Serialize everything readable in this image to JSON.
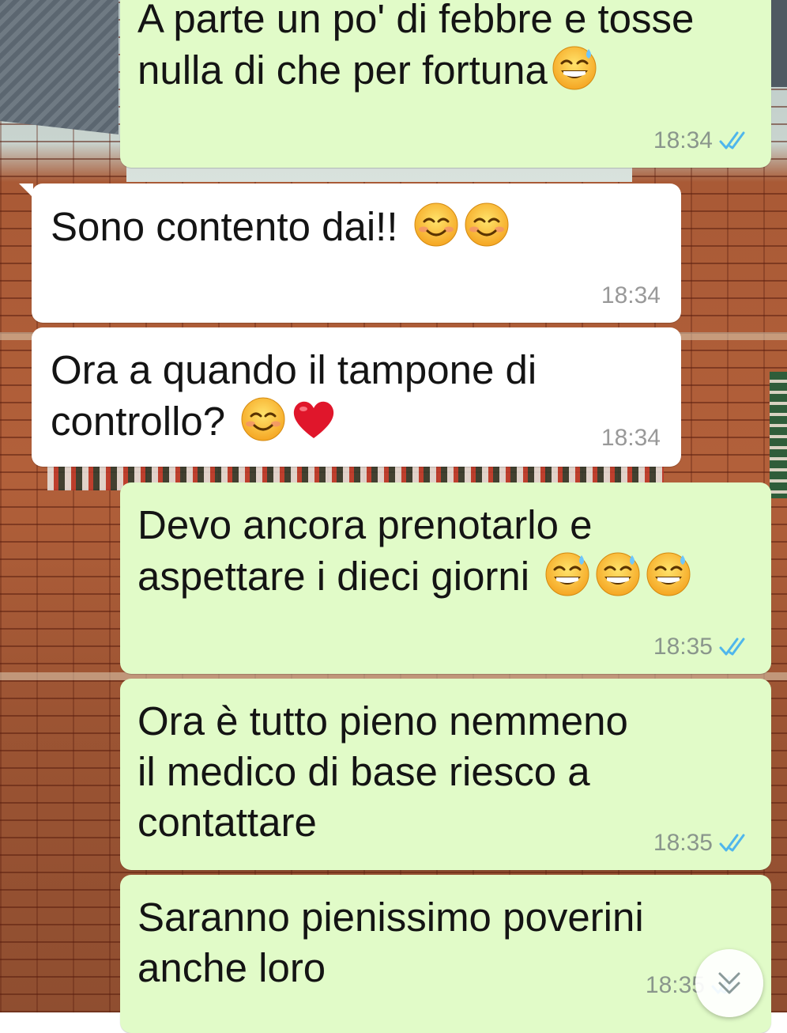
{
  "chat": {
    "messages": [
      {
        "direction": "outgoing",
        "lines": [
          "A parte un po' di febbre e tosse",
          "nulla di che per fortuna"
        ],
        "emoji": [
          "grinning-face-with-sweat"
        ],
        "time": "18:34",
        "status": "read"
      },
      {
        "direction": "incoming",
        "lines": [
          "Sono contento dai!!"
        ],
        "emoji": [
          "smiling-face-with-smiling-eyes",
          "smiling-face-with-smiling-eyes"
        ],
        "time": "18:34"
      },
      {
        "direction": "incoming",
        "lines": [
          "Ora a quando il tampone di",
          "controllo?"
        ],
        "emoji": [
          "smiling-face-with-smiling-eyes",
          "red-heart"
        ],
        "time": "18:34"
      },
      {
        "direction": "outgoing",
        "lines": [
          "Devo ancora prenotarlo e",
          "aspettare i dieci giorni"
        ],
        "emoji": [
          "grinning-face-with-sweat",
          "grinning-face-with-sweat",
          "grinning-face-with-sweat"
        ],
        "time": "18:35",
        "status": "read"
      },
      {
        "direction": "outgoing",
        "lines": [
          "Ora è tutto pieno nemmeno",
          "il medico di base riesco a",
          "contattare"
        ],
        "emoji": [],
        "time": "18:35",
        "status": "read"
      },
      {
        "direction": "outgoing",
        "lines": [
          "Saranno pienissimo poverini",
          "anche loro"
        ],
        "emoji": [],
        "time": "18:35",
        "status": "read"
      }
    ]
  },
  "colors": {
    "outgoing_bubble": "#e1fbc8",
    "incoming_bubble": "#ffffff",
    "read_ticks": "#4fb6ec"
  },
  "icons": {
    "read_receipt": "double-check-icon",
    "scroll_down": "double-chevron-down-icon"
  }
}
